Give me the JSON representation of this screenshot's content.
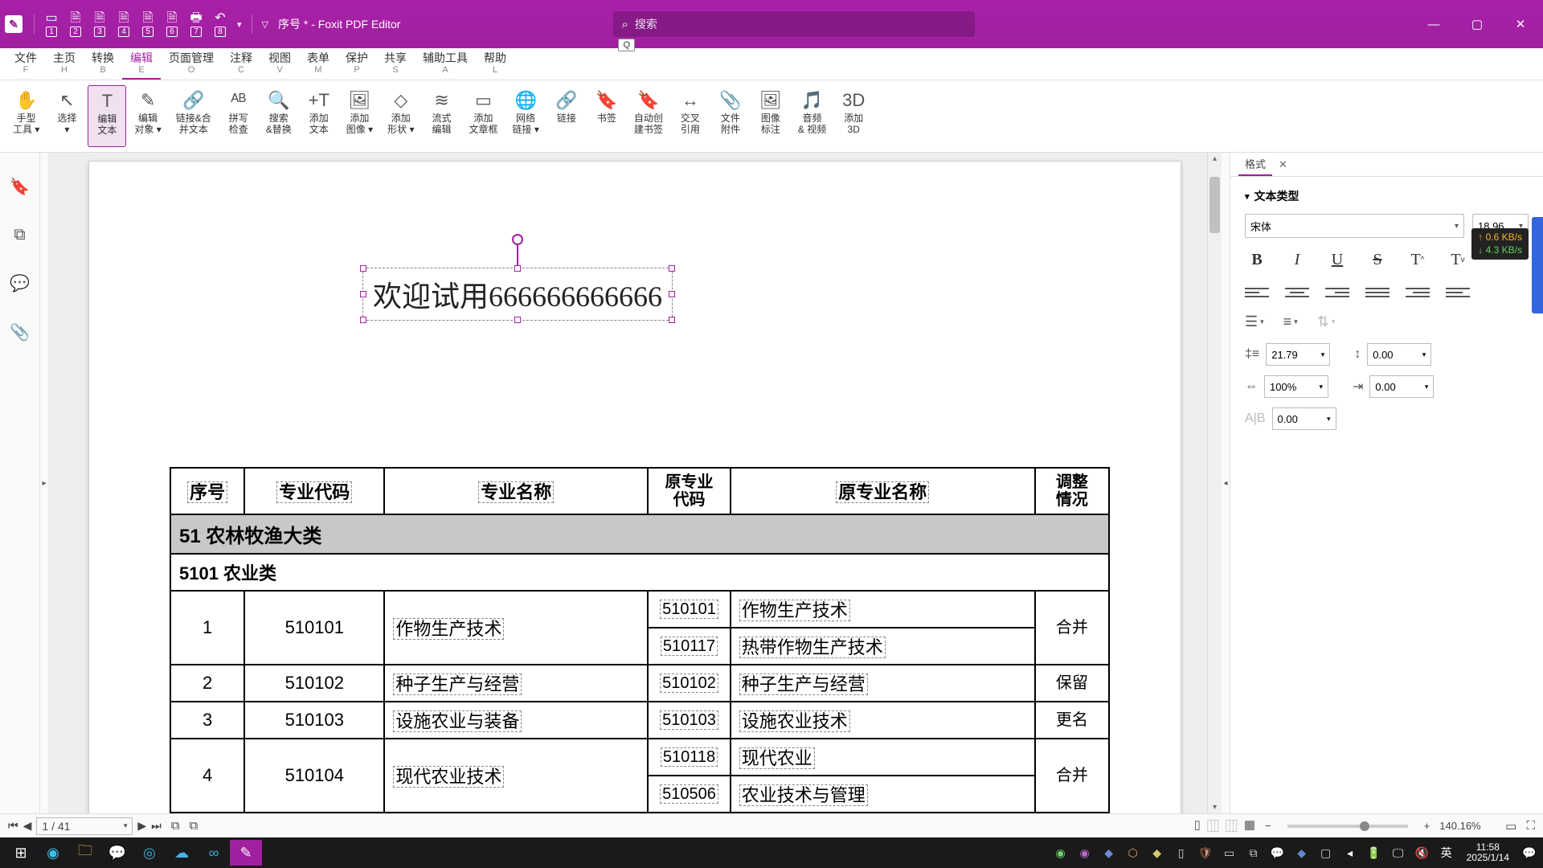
{
  "titlebar": {
    "quick_numbers": [
      "1",
      "2",
      "3",
      "4",
      "5",
      "6",
      "7",
      "8"
    ],
    "title": "序号 * - Foxit PDF Editor",
    "search_placeholder": "搜索",
    "search_shortcut": "Q"
  },
  "menu": {
    "tabs": [
      {
        "label": "文件",
        "key": "F"
      },
      {
        "label": "主页",
        "key": "H"
      },
      {
        "label": "转换",
        "key": "B"
      },
      {
        "label": "编辑",
        "key": "E",
        "active": true
      },
      {
        "label": "页面管理",
        "key": "O"
      },
      {
        "label": "注释",
        "key": "C"
      },
      {
        "label": "视图",
        "key": "V"
      },
      {
        "label": "表单",
        "key": "M"
      },
      {
        "label": "保护",
        "key": "P"
      },
      {
        "label": "共享",
        "key": "S"
      },
      {
        "label": "辅助工具",
        "key": "A"
      },
      {
        "label": "帮助",
        "key": "L"
      }
    ]
  },
  "ribbon": [
    {
      "label1": "手型",
      "label2": "工具 ▾"
    },
    {
      "label1": "选择",
      "label2": "▾"
    },
    {
      "label1": "编辑",
      "label2": "文本",
      "active": true
    },
    {
      "label1": "编辑",
      "label2": "对象 ▾"
    },
    {
      "label1": "链接&合",
      "label2": "并文本"
    },
    {
      "label1": "拼写",
      "label2": "检查"
    },
    {
      "label1": "搜索",
      "label2": "&替换"
    },
    {
      "label1": "添加",
      "label2": "文本"
    },
    {
      "label1": "添加",
      "label2": "图像 ▾"
    },
    {
      "label1": "添加",
      "label2": "形状 ▾"
    },
    {
      "label1": "流式",
      "label2": "编辑"
    },
    {
      "label1": "添加",
      "label2": "文章框"
    },
    {
      "label1": "网络",
      "label2": "链接 ▾"
    },
    {
      "label1": "链接",
      "label2": ""
    },
    {
      "label1": "书签",
      "label2": ""
    },
    {
      "label1": "自动创",
      "label2": "建书签"
    },
    {
      "label1": "交叉",
      "label2": "引用"
    },
    {
      "label1": "文件",
      "label2": "附件"
    },
    {
      "label1": "图像",
      "label2": "标注"
    },
    {
      "label1": "音频",
      "label2": "& 视频"
    },
    {
      "label1": "添加",
      "label2": "3D"
    }
  ],
  "document": {
    "edit_text": "欢迎试用666666666666",
    "headers": [
      "序号",
      "专业代码",
      "专业名称",
      "原专业\n代码",
      "原专业名称",
      "调整\n情况"
    ],
    "category": "51 农林牧渔大类",
    "subcategory": "5101 农业类",
    "rows": [
      {
        "idx": "1",
        "code": "510101",
        "name": "作物生产技术",
        "sub": [
          [
            "510101",
            "作物生产技术"
          ],
          [
            "510117",
            "热带作物生产技术"
          ]
        ],
        "adj": "合并"
      },
      {
        "idx": "2",
        "code": "510102",
        "name": "种子生产与经营",
        "sub": [
          [
            "510102",
            "种子生产与经营"
          ]
        ],
        "adj": "保留"
      },
      {
        "idx": "3",
        "code": "510103",
        "name": "设施农业与装备",
        "sub": [
          [
            "510103",
            "设施农业技术"
          ]
        ],
        "adj": "更名"
      },
      {
        "idx": "4",
        "code": "510104",
        "name": "现代农业技术",
        "sub": [
          [
            "510118",
            "现代农业"
          ],
          [
            "510506",
            "农业技术与管理"
          ]
        ],
        "adj": "合并"
      }
    ]
  },
  "format_panel": {
    "tab": "格式",
    "section": "文本类型",
    "font_name": "宋体",
    "font_size": "18.96",
    "line_spacing": "21.79",
    "char_spacing": "0.00",
    "scale": "100%",
    "indent": "0.00",
    "baseline": "0.00"
  },
  "net": {
    "up": "↑ 0.6 KB/s",
    "down": "↓ 4.3 KB/s"
  },
  "status": {
    "page": "1 / 41",
    "zoom": "140.16%"
  },
  "taskbar": {
    "ime": "英",
    "time": "11:58",
    "date": "2025/1/14"
  }
}
